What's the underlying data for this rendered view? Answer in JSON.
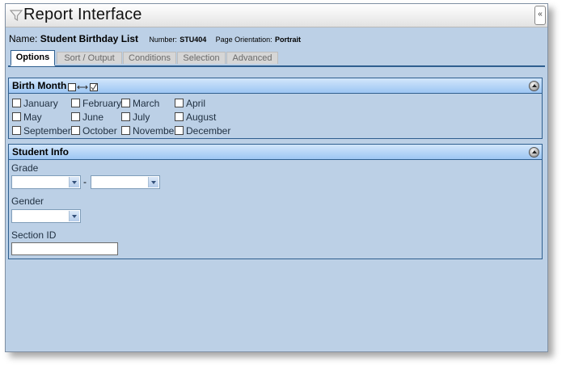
{
  "window": {
    "title": "Report Interface",
    "collapse_label": "«"
  },
  "report": {
    "name_label": "Name:",
    "name_value": "Student Birthday List",
    "number_label": "Number:",
    "number_value": "STU404",
    "orientation_label": "Page Orientation:",
    "orientation_value": "Portrait"
  },
  "tabs": [
    {
      "label": "Options",
      "active": true
    },
    {
      "label": "Sort / Output"
    },
    {
      "label": "Conditions"
    },
    {
      "label": "Selection"
    },
    {
      "label": "Advanced"
    }
  ],
  "birth_month": {
    "title": "Birth Month",
    "months": [
      {
        "label": "January",
        "checked": false
      },
      {
        "label": "February",
        "checked": false
      },
      {
        "label": "March",
        "checked": false
      },
      {
        "label": "April",
        "checked": false
      },
      {
        "label": "May",
        "checked": false
      },
      {
        "label": "June",
        "checked": false
      },
      {
        "label": "July",
        "checked": false
      },
      {
        "label": "August",
        "checked": false
      },
      {
        "label": "September",
        "checked": false
      },
      {
        "label": "October",
        "checked": false
      },
      {
        "label": "November",
        "checked": false
      },
      {
        "label": "December",
        "checked": false
      }
    ]
  },
  "student_info": {
    "title": "Student Info",
    "grade_label": "Grade",
    "grade_from": "",
    "grade_separator": "-",
    "grade_to": "",
    "gender_label": "Gender",
    "gender_value": "",
    "section_id_label": "Section ID",
    "section_id_value": ""
  },
  "colors": {
    "panel_bg": "#bcd0e6",
    "section_header": "#9dc6f3",
    "border": "#2f5f8f"
  }
}
